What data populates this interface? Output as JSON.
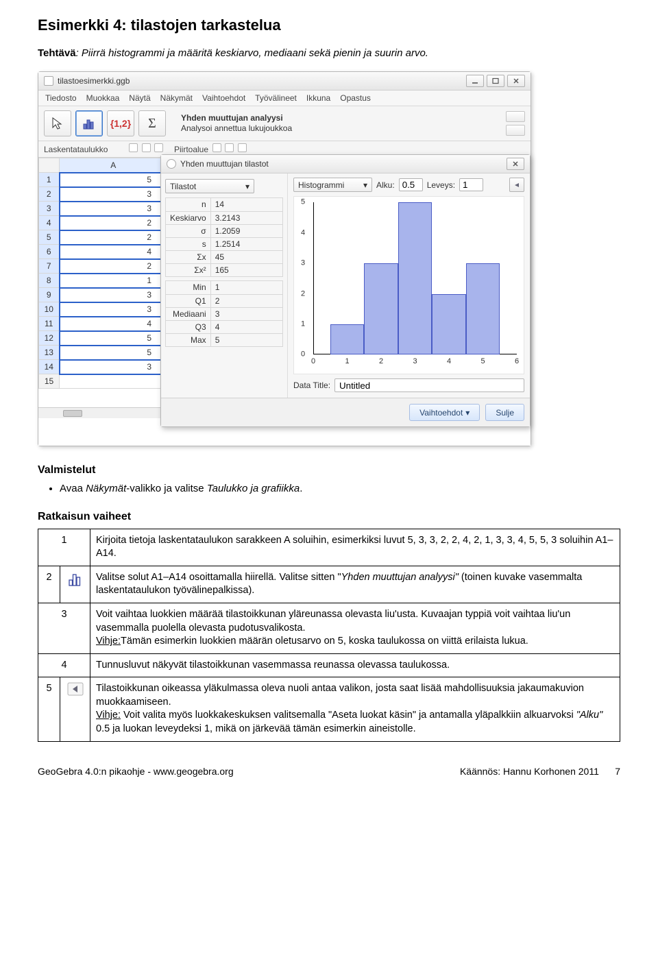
{
  "title": "Esimerkki 4: tilastojen tarkastelua",
  "task_label": "Tehtävä",
  "task_text": ": Piirrä histogrammi ja määritä keskiarvo, mediaani sekä pienin ja suurin arvo.",
  "app": {
    "filename": "tilastoesimerkki.ggb",
    "menu": [
      "Tiedosto",
      "Muokkaa",
      "Näytä",
      "Näkymät",
      "Vaihtoehdot",
      "Työvälineet",
      "Ikkuna",
      "Opastus"
    ],
    "tool_set": "{1,2}",
    "tool_sigma": "Σ",
    "tool_hint_title": "Yhden muuttujan analyysi",
    "tool_hint_sub": "Analysoi annettua lukujoukkoa",
    "panel_left": "Laskentataulukko",
    "panel_right": "Piirtoalue",
    "col": "A",
    "rows": [
      {
        "r": "1",
        "v": "5"
      },
      {
        "r": "2",
        "v": "3"
      },
      {
        "r": "3",
        "v": "3"
      },
      {
        "r": "4",
        "v": "2"
      },
      {
        "r": "5",
        "v": "2"
      },
      {
        "r": "6",
        "v": "4"
      },
      {
        "r": "7",
        "v": "2"
      },
      {
        "r": "8",
        "v": "1"
      },
      {
        "r": "9",
        "v": "3"
      },
      {
        "r": "10",
        "v": "3"
      },
      {
        "r": "11",
        "v": "4"
      },
      {
        "r": "12",
        "v": "5"
      },
      {
        "r": "13",
        "v": "5"
      },
      {
        "r": "14",
        "v": "3"
      },
      {
        "r": "15",
        "v": ""
      }
    ],
    "dialog": {
      "title": "Yhden muuttujan tilastot",
      "left_dd": "Tilastot",
      "right_dd": "Histogrammi",
      "alku_label": "Alku:",
      "alku_val": "0.5",
      "leveys_label": "Leveys:",
      "leveys_val": "1",
      "stats": [
        {
          "l": "n",
          "v": "14"
        },
        {
          "l": "Keskiarvo",
          "v": "3.2143"
        },
        {
          "l": "σ",
          "v": "1.2059"
        },
        {
          "l": "s",
          "v": "1.2514"
        },
        {
          "l": "Σx",
          "v": "45"
        },
        {
          "l": "Σx²",
          "v": "165"
        }
      ],
      "stats2": [
        {
          "l": "Min",
          "v": "1"
        },
        {
          "l": "Q1",
          "v": "2"
        },
        {
          "l": "Mediaani",
          "v": "3"
        },
        {
          "l": "Q3",
          "v": "4"
        },
        {
          "l": "Max",
          "v": "5"
        }
      ],
      "data_title_label": "Data Title:",
      "data_title_val": "Untitled",
      "btn_options": "Vaihtoehdot",
      "btn_close": "Sulje"
    }
  },
  "chart_data": {
    "type": "bar",
    "categories": [
      "1",
      "2",
      "3",
      "4",
      "5"
    ],
    "values": [
      1,
      3,
      5,
      2,
      3
    ],
    "xlabel": "",
    "ylabel": "",
    "xlim": [
      0,
      6
    ],
    "ylim": [
      0,
      5
    ],
    "x_ticks": [
      "0",
      "1",
      "2",
      "3",
      "4",
      "5",
      "6"
    ],
    "y_ticks": [
      "0",
      "1",
      "2",
      "3",
      "4",
      "5"
    ]
  },
  "prep_heading": "Valmistelut",
  "prep_bullet_pre": "Avaa ",
  "prep_bullet_it1": "Näkymät",
  "prep_bullet_mid": "-valikko ja valitse ",
  "prep_bullet_it2": "Taulukko ja grafiikka",
  "prep_bullet_post": ".",
  "steps_heading": "Ratkaisun vaiheet",
  "steps": {
    "s1": "Kirjoita tietoja laskentataulukon sarakkeen A soluihin, esimerkiksi luvut  5, 3, 3, 2, 2, 4, 2, 1, 3, 3, 4, 5, 5, 3 soluihin A1–A14.",
    "s2a": "Valitse solut A1–A14 osoittamalla hiirellä. Valitse sitten \"",
    "s2b": "Yhden muuttujan analyysi\" ",
    "s2c": "(toinen kuvake vasemmalta laskentataulukon työvälinepalkissa).",
    "s3a": "Voit vaihtaa luokkien määrää tilastoikkunan yläreunassa olevasta liu'usta. Kuvaajan typpiä voit vaihtaa liu'un vasemmalla puolella olevasta pudotusvalikosta.",
    "s3b_u": "Vihje:",
    "s3b": "Tämän esimerkin luokkien määrän oletusarvo on 5, koska taulukossa on viittä erilaista lukua.",
    "s4": "Tunnusluvut näkyvät tilastoikkunan vasemmassa reunassa olevassa taulukossa.",
    "s5a": "Tilastoikkunan oikeassa yläkulmassa oleva nuoli antaa valikon, josta saat lisää mahdollisuuksia jakaumakuvion muokkaamiseen.",
    "s5b_u": "Vihje:",
    "s5b": " Voit valita myös luokkakeskuksen valitsemalla \"Aseta luokat käsin\" ja antamalla yläpalkkiin alkuarvoksi ",
    "s5c": "\"Alku\"",
    "s5d": " 0.5 ja luokan leveydeksi 1, mikä on järkevää tämän esimerkin aineistolle."
  },
  "footer_left": "GeoGebra 4.0:n pikaohje - www.geogebra.org",
  "footer_right": "Käännös: Hannu Korhonen 2011",
  "footer_page": "7"
}
